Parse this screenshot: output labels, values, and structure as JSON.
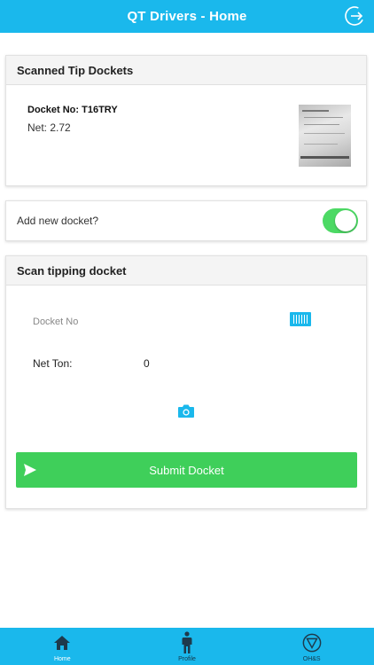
{
  "header": {
    "title": "QT Drivers - Home",
    "logout_icon": "logout-icon"
  },
  "scanned_card": {
    "title": "Scanned Tip Dockets",
    "docket": {
      "docket_no": "Docket No: T16TRY",
      "net": "Net: 2.72"
    }
  },
  "new_docket": {
    "label": "Add new docket?",
    "toggle_on": true
  },
  "scan_card": {
    "title": "Scan tipping docket",
    "docket_placeholder": "Docket No",
    "docket_value": "",
    "net_label": "Net Ton:",
    "net_value": "0",
    "submit_label": "Submit Docket"
  },
  "tabs": [
    {
      "label": "Home",
      "icon": "home-icon",
      "active": true
    },
    {
      "label": "Profile",
      "icon": "person-icon",
      "active": false
    },
    {
      "label": "OH&S",
      "icon": "shield-icon",
      "active": false
    }
  ],
  "colors": {
    "accent": "#1ab8ec",
    "submit": "#3fcf5a",
    "toggle": "#4cd964"
  }
}
